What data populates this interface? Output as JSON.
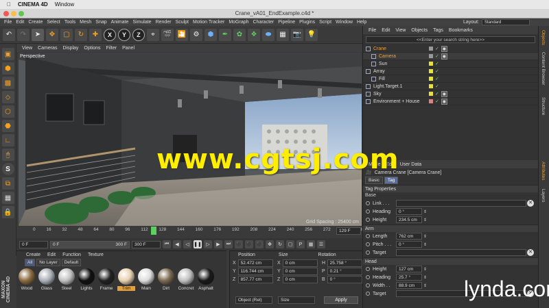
{
  "mac_menu": {
    "app": "CINEMA 4D",
    "window": "Window"
  },
  "window_title": "Crane_vA01_EndExample.c4d *",
  "main_menu": [
    "File",
    "Edit",
    "Create",
    "Select",
    "Tools",
    "Mesh",
    "Snap",
    "Animate",
    "Simulate",
    "Render",
    "Sculpt",
    "Motion Tracker",
    "MoGraph",
    "Character",
    "Pipeline",
    "Plugins",
    "Script",
    "Window",
    "Help"
  ],
  "layout": {
    "label": "Layout:",
    "value": "Standard"
  },
  "toolbar": {
    "x": "X",
    "y": "Y",
    "z": "Z"
  },
  "viewport": {
    "menu": [
      "View",
      "Cameras",
      "Display",
      "Options",
      "Filter",
      "Panel"
    ],
    "label": "Perspective",
    "grid_spacing": "Grid Spacing : 25400 cm"
  },
  "timeline": {
    "ticks": [
      "0",
      "16",
      "32",
      "48",
      "64",
      "80",
      "96",
      "112",
      "128",
      "144",
      "160",
      "176",
      "192",
      "208",
      "224",
      "240",
      "256",
      "272",
      "288",
      "3"
    ],
    "end_field": "129 F"
  },
  "playback": {
    "start": "0 F",
    "min": "0 F",
    "max": "300 F",
    "end": "300 F"
  },
  "material_manager": {
    "menu": [
      "Create",
      "Edit",
      "Function",
      "Texture"
    ],
    "filters": [
      "All",
      "No Layer",
      "Default"
    ],
    "materials": [
      {
        "name": "Wood",
        "color": "#8a6a40"
      },
      {
        "name": "Glass",
        "color": "#aab0b8"
      },
      {
        "name": "Steel",
        "color": "#c0c0c0"
      },
      {
        "name": "Lights",
        "color": "#101010"
      },
      {
        "name": "Frame",
        "color": "#222222"
      },
      {
        "name": "Trim",
        "color": "#e8d0b0"
      },
      {
        "name": "Main",
        "color": "#dddddd"
      },
      {
        "name": "Dirt",
        "color": "#7a6a50"
      },
      {
        "name": "Concret",
        "color": "#bfbfbf"
      },
      {
        "name": "Asphalt",
        "color": "#1a1a1a"
      }
    ],
    "selected": "Trim"
  },
  "coords": {
    "headers": [
      "Position",
      "Size",
      "Rotation"
    ],
    "rows": [
      {
        "a": "X",
        "p": "52.472 cm",
        "b": "X",
        "s": "0 cm",
        "c": "H",
        "r": "25.758 °"
      },
      {
        "a": "Y",
        "p": "116.744 cm",
        "b": "Y",
        "s": "0 cm",
        "c": "P",
        "r": "0.21 °"
      },
      {
        "a": "Z",
        "p": "857.77 cm",
        "b": "Z",
        "s": "0 cm",
        "c": "B",
        "r": "0 °"
      }
    ],
    "mode": "Object (Rel)",
    "size_mode": "Size",
    "apply": "Apply"
  },
  "objects_manager": {
    "menu": [
      "File",
      "Edit",
      "View",
      "Objects",
      "Tags",
      "Bookmarks"
    ],
    "search_placeholder": "<<Enter your search string here>>",
    "items": [
      {
        "name": "Crane",
        "indent": 0,
        "color": "grey",
        "style": "hl"
      },
      {
        "name": "Camera",
        "indent": 1,
        "color": "grey",
        "style": "sel"
      },
      {
        "name": "Sun",
        "indent": 1,
        "color": "yellow",
        "style": ""
      },
      {
        "name": "Array",
        "indent": 0,
        "color": "yellow",
        "style": ""
      },
      {
        "name": "Fill",
        "indent": 1,
        "color": "yellow",
        "style": ""
      },
      {
        "name": "Light.Target.1",
        "indent": 0,
        "color": "yellow",
        "style": ""
      },
      {
        "name": "Sky",
        "indent": 0,
        "color": "yellow",
        "style": ""
      },
      {
        "name": "Environment + House",
        "indent": 0,
        "color": "pink",
        "style": ""
      }
    ]
  },
  "attributes": {
    "menu": [
      "Mode",
      "Edit",
      "User Data"
    ],
    "title": "Camera Crane [Camera Crane]",
    "tabs": [
      "Basic",
      "Tag"
    ],
    "active_tab": "Tag",
    "section": "Tag Properties",
    "base_label": "Base",
    "base": [
      {
        "label": "Link . . .",
        "value": ""
      },
      {
        "label": "Heading",
        "value": "0 °"
      },
      {
        "label": "Height",
        "value": "234.5 cm"
      }
    ],
    "arm_label": "Arm",
    "arm": [
      {
        "label": "Length",
        "value": "762 cm"
      },
      {
        "label": "Pitch . . .",
        "value": "0 °"
      },
      {
        "label": "Target",
        "value": ""
      }
    ],
    "head_label": "Head",
    "head": [
      {
        "label": "Height",
        "value": "127 cm"
      },
      {
        "label": "Heading",
        "value": "25.7 °"
      },
      {
        "label": "Width . .",
        "value": "88.9 cm"
      },
      {
        "label": "Target",
        "value": ""
      }
    ]
  },
  "side_tabs": [
    "Objects",
    "Content Browser",
    "Structure",
    "Attributes",
    "Layers"
  ],
  "watermark_site": "www.cgtsj.com",
  "watermark_brand": "lynda.com",
  "maxon_logo": "MAXON CINEMA 4D"
}
